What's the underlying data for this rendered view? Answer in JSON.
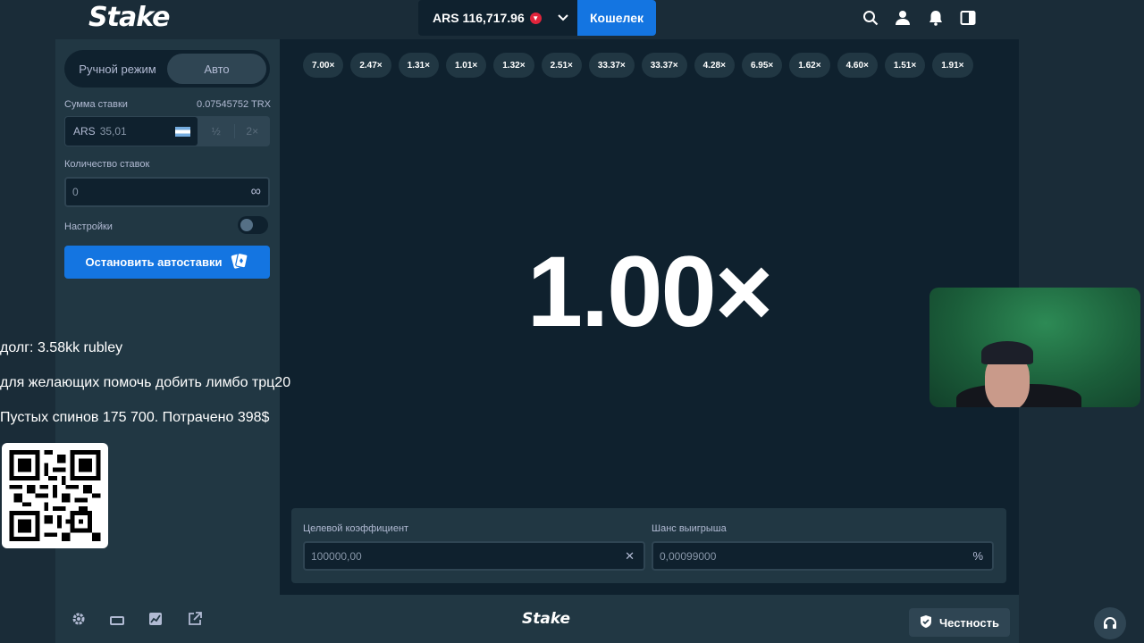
{
  "header": {
    "logo": "Stake",
    "balance": "ARS 116,717.96",
    "wallet_label": "Кошелек"
  },
  "sidebar": {
    "mode_manual": "Ручной режим",
    "mode_auto": "Авто",
    "bet_amount_label": "Сумма ставки",
    "bet_amount_crypto": "0.07545752 TRX",
    "bet_currency": "ARS",
    "bet_value": "35,01",
    "half_label": "½",
    "double_label": "2×",
    "bet_count_label": "Количество ставок",
    "bet_count_value": "0",
    "infinity_symbol": "∞",
    "settings_label": "Настройки",
    "stop_autobet_label": "Остановить автоставки"
  },
  "game": {
    "history": [
      "7.00×",
      "2.47×",
      "1.31×",
      "1.01×",
      "1.32×",
      "2.51×",
      "33.37×",
      "33.37×",
      "4.28×",
      "6.95×",
      "1.62×",
      "4.60×",
      "1.51×",
      "1.91×"
    ],
    "result": "1.00×",
    "target_label": "Целевой коэффициент",
    "target_value": "100000,00",
    "target_suffix": "✕",
    "chance_label": "Шанс выигрыша",
    "chance_value": "0,00099000",
    "chance_suffix": "%"
  },
  "footer": {
    "logo": "Stake",
    "fairness_label": "Честность"
  },
  "overlay": {
    "line1": "долг: 3.58kk rubley",
    "line2": "для желающих помочь добить лимбо трц20",
    "line3": "Пустых спинов 175 700. Потрачено 398$"
  },
  "colors": {
    "background": "#1a2c38",
    "panel": "#213743",
    "game_bg": "#0f212e",
    "accent": "#1475e1",
    "muted_text": "#b1bad3"
  }
}
